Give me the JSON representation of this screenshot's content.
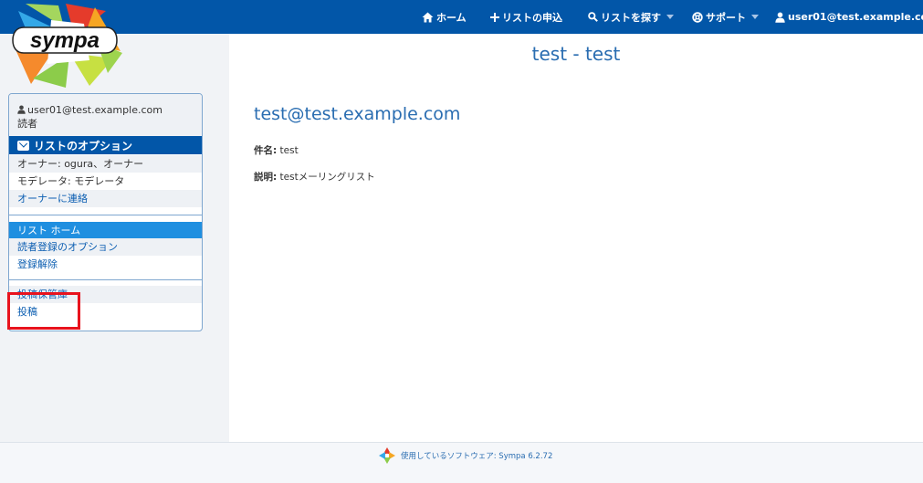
{
  "topbar": {
    "home_label": "ホーム",
    "request_label": "リストの申込",
    "search_label": "リストを探す",
    "support_label": "サポート",
    "user_label": "user01@test.example.com"
  },
  "logo": {
    "text": "sympa"
  },
  "sidebar": {
    "user_email": "user01@test.example.com",
    "user_role": "読者",
    "options_header": "リストのオプション",
    "owner": "オーナー: ogura、オーナー",
    "moderator": "モデレータ: モデレータ",
    "contact_owner": "オーナーに連絡",
    "list_home": "リスト ホーム",
    "subscriber_options": "読者登録のオプション",
    "unsubscribe": "登録解除",
    "archives": "投稿保管庫",
    "post": "投稿"
  },
  "main": {
    "page_title": "test - test",
    "list_address": "test@test.example.com",
    "subject_label": "件名:",
    "subject_value": "test",
    "description_label": "説明:",
    "description_value": "testメーリングリスト"
  },
  "footer": {
    "text": "使用しているソフトウェア: Sympa 6.2.72"
  },
  "colors": {
    "topbar": "#0256a8",
    "link": "#2a6db1",
    "highlight_box": "#e8131d"
  }
}
